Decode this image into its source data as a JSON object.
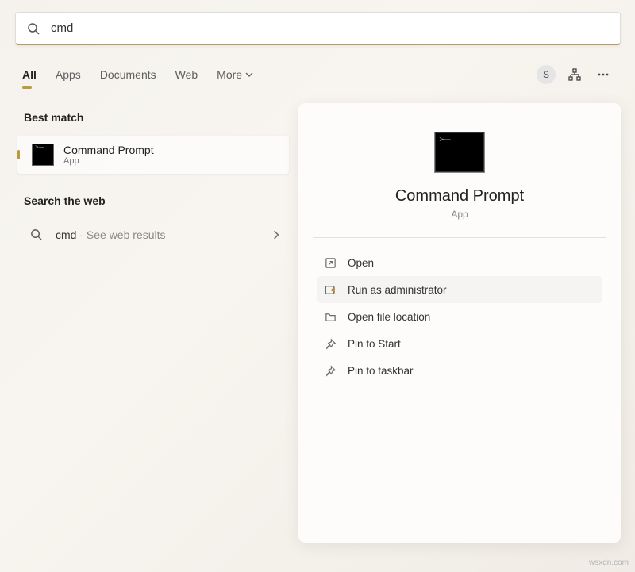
{
  "search": {
    "query": "cmd"
  },
  "tabs": {
    "items": [
      {
        "label": "All",
        "active": true
      },
      {
        "label": "Apps",
        "active": false
      },
      {
        "label": "Documents",
        "active": false
      },
      {
        "label": "Web",
        "active": false
      },
      {
        "label": "More",
        "active": false,
        "dropdown": true
      }
    ]
  },
  "avatar": {
    "initial": "S"
  },
  "results": {
    "best_match_header": "Best match",
    "best_match": {
      "title": "Command Prompt",
      "subtitle": "App"
    },
    "web_header": "Search the web",
    "web_item": {
      "query": "cmd",
      "hint": " - See web results"
    }
  },
  "preview": {
    "title": "Command Prompt",
    "subtitle": "App",
    "actions": [
      {
        "icon": "open-icon",
        "label": "Open"
      },
      {
        "icon": "admin-icon",
        "label": "Run as administrator",
        "hover": true
      },
      {
        "icon": "folder-icon",
        "label": "Open file location"
      },
      {
        "icon": "pin-icon",
        "label": "Pin to Start"
      },
      {
        "icon": "pin-icon",
        "label": "Pin to taskbar"
      }
    ]
  },
  "watermark": "wsxdn.com"
}
